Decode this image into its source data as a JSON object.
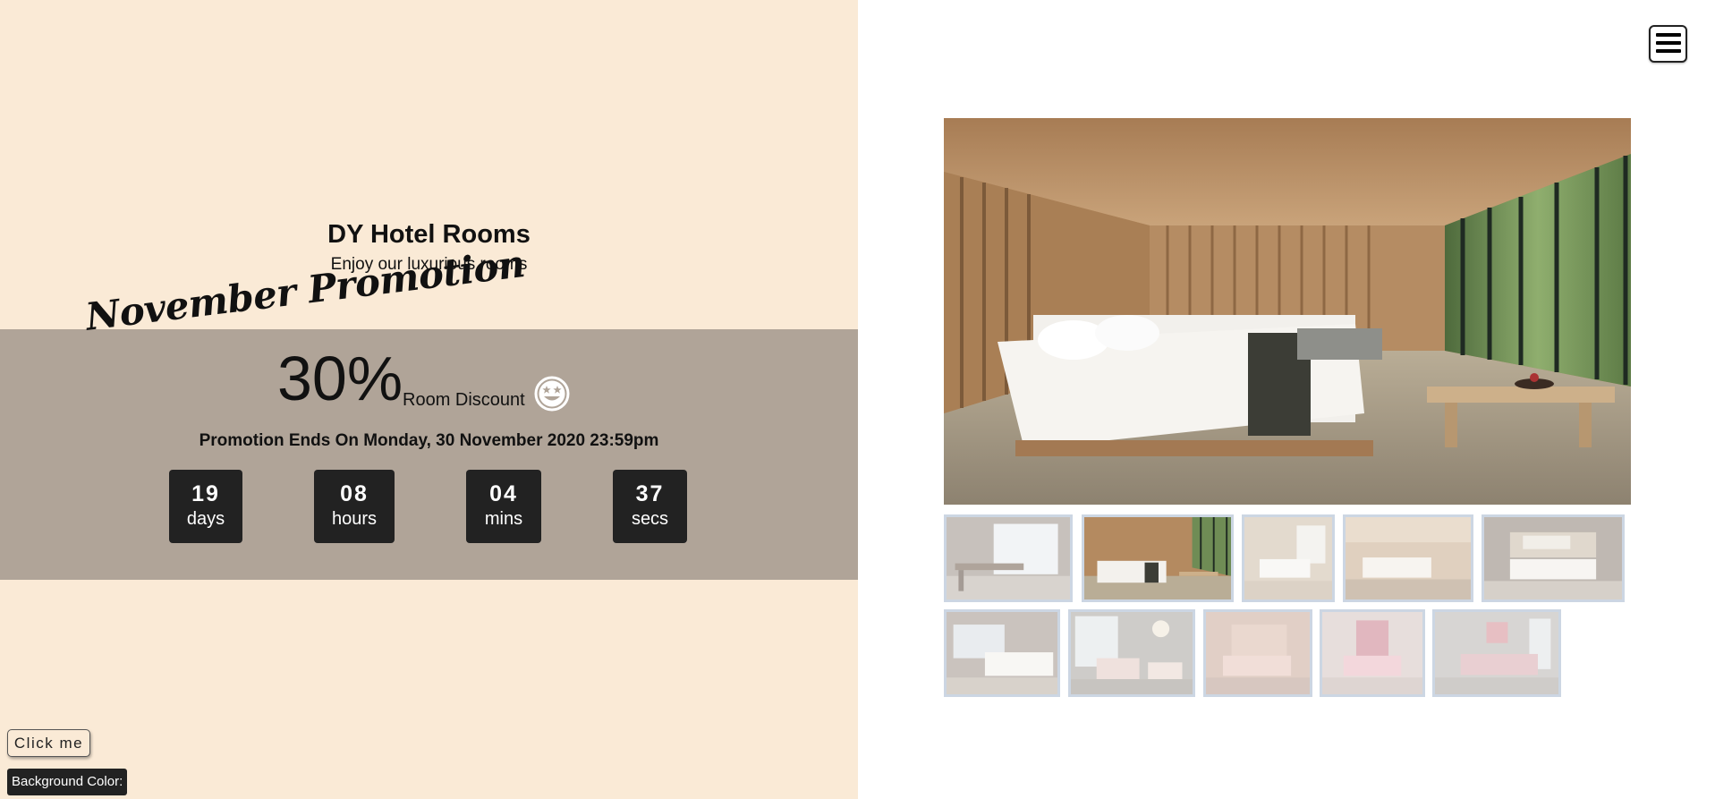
{
  "hero": {
    "title": "DY Hotel Rooms",
    "subtitle": "Enjoy our luxurious rooms"
  },
  "promotion": {
    "heading": "November Promotion",
    "percent": "30%",
    "label": "Room Discount",
    "ends_text": "Promotion Ends On Monday, 30 November 2020 23:59pm",
    "icon": "smiling-star-eyes-icon"
  },
  "countdown": [
    {
      "value": "19",
      "unit": "days"
    },
    {
      "value": "08",
      "unit": "hours"
    },
    {
      "value": "04",
      "unit": "mins"
    },
    {
      "value": "37",
      "unit": "secs"
    }
  ],
  "controls": {
    "click_button": "Click me",
    "bg_color_label": "Background Color:"
  },
  "nav": {
    "menu_icon": "hamburger-menu-icon"
  },
  "gallery": {
    "selected_index": 1,
    "thumbnails": [
      "room-1",
      "room-2",
      "room-3",
      "room-4",
      "room-5",
      "room-6",
      "room-7",
      "room-8",
      "room-9",
      "room-10"
    ]
  },
  "colors": {
    "left_bg": "#faead6",
    "promo_band": "#b0a498",
    "countdown_box": "#222222",
    "thumb_border": "#ccd6e3"
  }
}
